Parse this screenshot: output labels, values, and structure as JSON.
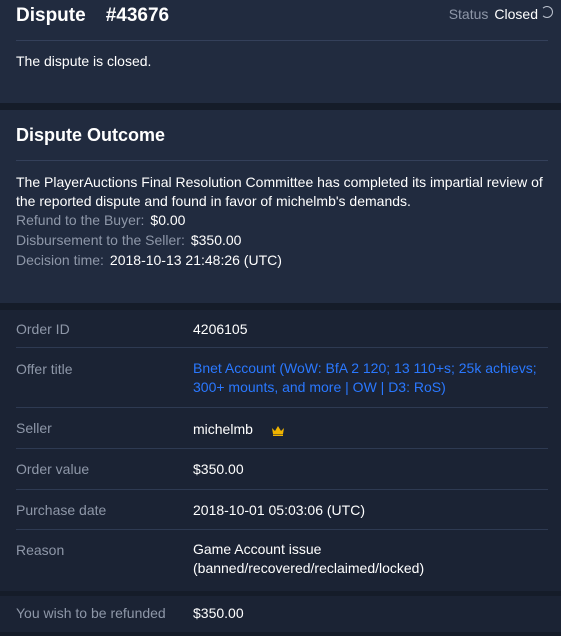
{
  "header": {
    "title": "Dispute",
    "number": "#43676",
    "status_label": "Status",
    "status_value": "Closed",
    "message": "The dispute is closed."
  },
  "outcome": {
    "heading": "Dispute Outcome",
    "description": "The PlayerAuctions Final Resolution Committee has completed its impartial review of the reported dispute and found in favor of michelmb's demands.",
    "refund_label": "Refund to the Buyer:",
    "refund_value": "$0.00",
    "disbursement_label": "Disbursement to the Seller:",
    "disbursement_value": "$350.00",
    "decision_label": "Decision time:",
    "decision_value": "2018-10-13 21:48:26 (UTC)"
  },
  "order": {
    "rows": [
      {
        "label": "Order ID",
        "value": "4206105"
      },
      {
        "label": "Offer title",
        "value": "Bnet Account (WoW: BfA 2 120; 13 110+s; 25k achievs; 300+ mounts, and more | OW | D3: RoS)"
      },
      {
        "label": "Seller",
        "value": "michelmb"
      },
      {
        "label": "Order value",
        "value": "$350.00"
      },
      {
        "label": "Purchase date",
        "value": "2018-10-01 05:03:06 (UTC)"
      },
      {
        "label": "Reason",
        "value": "Game Account issue (banned/recovered/reclaimed/locked)"
      }
    ]
  },
  "refund": {
    "label": "You wish to be refunded",
    "value": "$350.00"
  },
  "colors": {
    "link": "#2a78ff",
    "crown": "#f0b400"
  },
  "icons": [
    "refresh-icon",
    "crown-icon"
  ]
}
